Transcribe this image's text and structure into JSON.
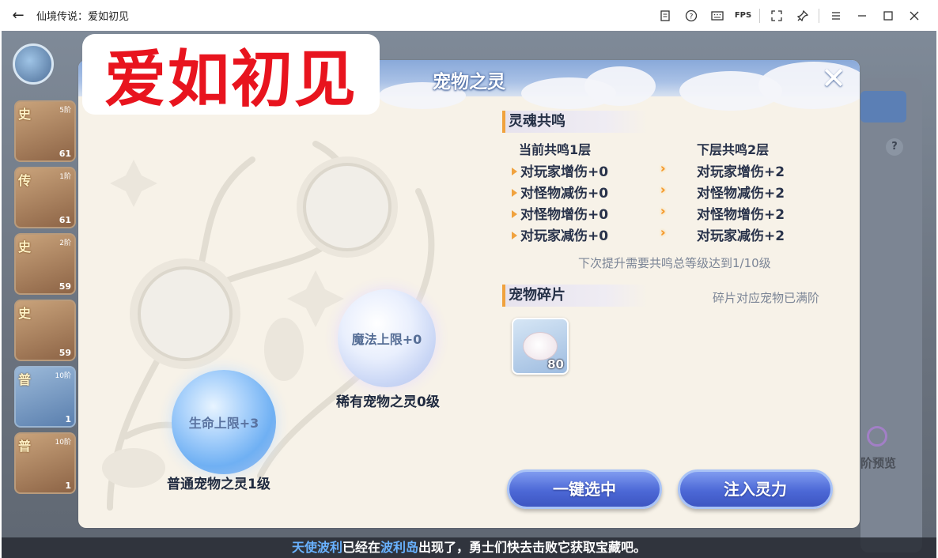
{
  "window": {
    "title": "仙境传说：爱如初见",
    "tools": [
      "doc-icon",
      "help-icon",
      "keyboard-icon",
      "FPS",
      "fullscreen-icon",
      "pin-icon",
      "menu-icon",
      "minimize-icon",
      "maximize-icon",
      "close-icon"
    ],
    "fps_label": "FPS"
  },
  "watermark": "爱如初见",
  "background": {
    "pet_cards": [
      {
        "grade": "史",
        "stage": "5阶",
        "level": "61"
      },
      {
        "grade": "传",
        "stage": "1阶",
        "level": "61"
      },
      {
        "grade": "史",
        "stage": "2阶",
        "level": "59"
      },
      {
        "grade": "史",
        "stage": "",
        "level": "59"
      },
      {
        "grade": "普",
        "stage": "10阶",
        "level": "1"
      },
      {
        "grade": "普",
        "stage": "10阶",
        "level": "1"
      }
    ],
    "right_preview": "阶预览",
    "help_glyph": "?"
  },
  "modal": {
    "title": "宠物之灵",
    "close_glyph": "✕",
    "spirits": [
      {
        "stat": "魔法上限+0",
        "name": "稀有宠物之灵0级"
      },
      {
        "stat": "生命上限+3",
        "name": "普通宠物之灵1级"
      }
    ],
    "resonance": {
      "section_title": "灵魂共鸣",
      "current_header": "当前共鸣1层",
      "next_header": "下层共鸣2层",
      "rows": [
        {
          "current": "对玩家增伤+0",
          "next": "对玩家增伤+2"
        },
        {
          "current": "对怪物减伤+0",
          "next": "对怪物减伤+2"
        },
        {
          "current": "对怪物增伤+0",
          "next": "对怪物增伤+2"
        },
        {
          "current": "对玩家减伤+0",
          "next": "对玩家减伤+2"
        }
      ],
      "hint": "下次提升需要共鸣总等级达到1/10级"
    },
    "fragments": {
      "section_title": "宠物碎片",
      "note": "碎片对应宠物已满阶",
      "item_count": "80"
    },
    "buttons": {
      "select_all": "一键选中",
      "inject": "注入灵力"
    }
  },
  "ticker": {
    "name1": "天使波利",
    "text1": "已经在",
    "name2": "波利岛",
    "text2": "出现了，勇士们快去击败它获取宝藏吧。"
  }
}
